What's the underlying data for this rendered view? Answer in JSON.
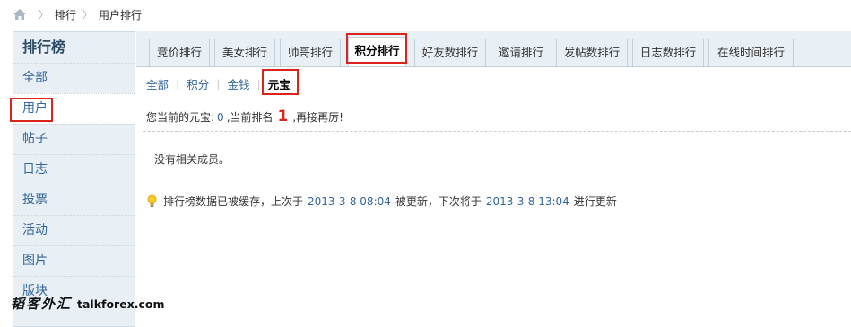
{
  "breadcrumb": {
    "home_icon": "home-icon",
    "items": [
      "排行",
      "用户排行"
    ]
  },
  "sidebar": {
    "title": "排行榜",
    "items": [
      {
        "label": "全部"
      },
      {
        "label": "用户"
      },
      {
        "label": "帖子"
      },
      {
        "label": "日志"
      },
      {
        "label": "投票"
      },
      {
        "label": "活动"
      },
      {
        "label": "图片"
      },
      {
        "label": "版块"
      }
    ]
  },
  "tabs": [
    {
      "label": "竞价排行"
    },
    {
      "label": "美女排行"
    },
    {
      "label": "帅哥排行"
    },
    {
      "label": "积分排行"
    },
    {
      "label": "好友数排行"
    },
    {
      "label": "邀请排行"
    },
    {
      "label": "发帖数排行"
    },
    {
      "label": "日志数排行"
    },
    {
      "label": "在线时间排行"
    }
  ],
  "subnav": [
    {
      "label": "全部"
    },
    {
      "label": "积分"
    },
    {
      "label": "金钱"
    },
    {
      "label": "元宝"
    }
  ],
  "info": {
    "prefix": "您当前的元宝:",
    "value": "0",
    "mid": ",当前排名",
    "rank": "1",
    "suffix": ",再接再厉!"
  },
  "empty_text": "没有相关成员。",
  "cache": {
    "icon": "lightbulb-icon",
    "text1": "排行榜数据已被缓存，上次于",
    "last_time": "2013-3-8 08:04",
    "text2": "被更新，下次将于",
    "next_time": "2013-3-8 13:04",
    "text3": "进行更新"
  },
  "watermark": {
    "cn": "韬客外汇",
    "en": "talkforex.com"
  },
  "colors": {
    "highlight": "#d9251c",
    "link": "#336699",
    "sidebar_bg": "#e8eff5"
  }
}
